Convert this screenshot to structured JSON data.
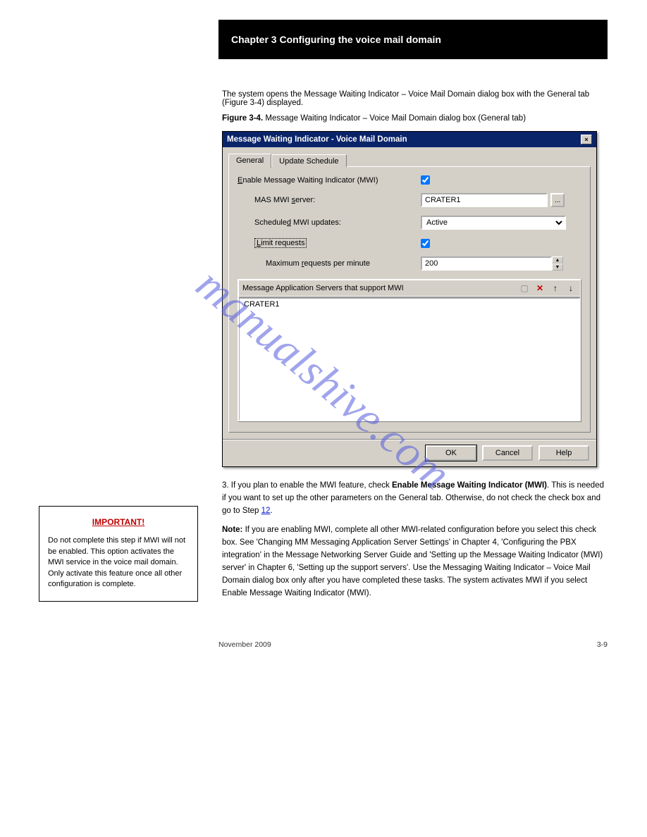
{
  "header": {
    "title": "Chapter 3    Configuring the voice mail domain"
  },
  "intro": "The system opens the Message Waiting Indicator – Voice Mail Domain dialog box with the General tab (Figure 3-4) displayed.",
  "fig": {
    "prefix_s": "Figure 3-4.",
    "caption_s": "Message Waiting Indicator – Voice Mail Domain dialog box (General tab)"
  },
  "dialog": {
    "title": "Message Waiting Indicator - Voice Mail Domain",
    "tabs": {
      "general": "General",
      "schedule": "Update Schedule"
    },
    "labels": {
      "enable": "Enable Message Waiting Indicator (MWI)",
      "mas_server_pre": "MAS MWI ",
      "mas_server_u": "s",
      "mas_server_post": "erver:",
      "scheduled_pre": "Schedule",
      "scheduled_u": "d",
      "scheduled_post": " MWI updates:",
      "limit_pre": "",
      "limit_u": "L",
      "limit_post": "imit requests",
      "maxreq_pre": "Maximum ",
      "maxreq_u": "r",
      "maxreq_post": "equests per minute",
      "servers_header": "Message Application Servers that support MWI"
    },
    "values": {
      "enable_checked": true,
      "mas_server": "CRATER1",
      "scheduled_option": "Active",
      "limit_checked": true,
      "max_requests": "200",
      "server_list": [
        "CRATER1"
      ]
    },
    "browse_label": "...",
    "buttons": {
      "ok": "OK",
      "cancel": "Cancel",
      "help": "Help"
    }
  },
  "callout": {
    "title": "IMPORTANT!",
    "body": "Do not complete this step if MWI will not be enabled. This option activates the MWI service in the voice mail domain. Only activate this feature once all other configuration is complete."
  },
  "para1": {
    "pre": "3. If you plan to enable the MWI feature, check ",
    "link": "Enable Message Waiting Indicator (MWI)",
    "post": ". This is needed if you want to set up the other parameters on the General tab. Otherwise, do not check the check box and go to Step ",
    "step_ref": "12",
    "suffix": "."
  },
  "note": {
    "prefix": "Note:",
    "body": "If you are enabling MWI, complete all other MWI-related configuration before you select this check box. See 'Changing MM Messaging Application Server Settings' in Chapter 4, 'Configuring the PBX integration' in the Message Networking Server Guide and 'Setting up the Message Waiting Indicator (MWI) server' in Chapter 6, 'Setting up the support servers'. Use the Messaging Waiting Indicator – Voice Mail Domain dialog box only after you have completed these tasks. The system activates MWI if you select Enable Message Waiting Indicator (MWI)."
  },
  "footer": {
    "left": "November 2009",
    "right": "3-9"
  },
  "watermark": "manualshive.com"
}
